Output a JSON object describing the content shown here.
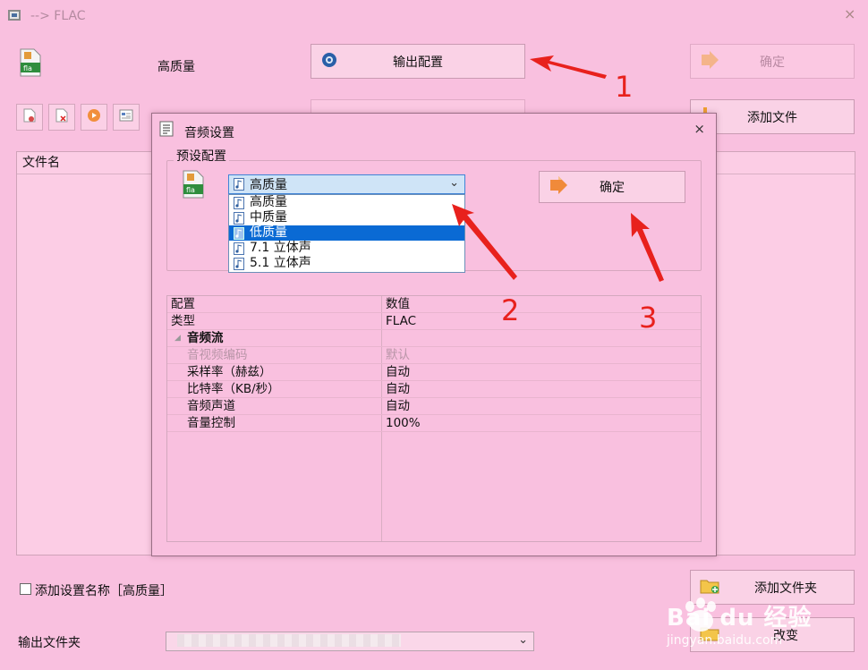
{
  "window": {
    "title": "--> FLAC",
    "close_glyph": "×"
  },
  "main": {
    "preset_name": "高质量",
    "output_config_label": "输出配置",
    "ok_label": "确定",
    "add_file_label": "添加文件",
    "add_folder_label": "添加文件夹",
    "change_label": "改变",
    "file_col_header": "文件名",
    "add_setting_name_label": "添加设置名称［高质量］",
    "output_folder_label": "输出文件夹"
  },
  "dialog": {
    "title": "音频设置",
    "close_glyph": "×",
    "preset_group_label": "预设配置",
    "combo_value": "高质量",
    "options": [
      "高质量",
      "中质量",
      "低质量",
      "7.1 立体声",
      "5.1 立体声"
    ],
    "selected_index": 2,
    "ok_label": "确定",
    "grid": {
      "col_headers": [
        "配置",
        "数值"
      ],
      "rows": [
        {
          "name": "类型",
          "value": "FLAC"
        },
        {
          "name": "音频流",
          "value": ""
        },
        {
          "name": "音视频编码",
          "value": "默认"
        },
        {
          "name": "采样率（赫兹）",
          "value": "自动"
        },
        {
          "name": "比特率（KB/秒）",
          "value": "自动"
        },
        {
          "name": "音频声道",
          "value": "自动"
        },
        {
          "name": "音量控制",
          "value": "100%"
        }
      ]
    }
  },
  "annotations": {
    "labels": [
      "1",
      "2",
      "3"
    ],
    "color": "#e8211d"
  },
  "watermark": {
    "brand": "Bai du 经验",
    "url": "jingyan.baidu.com"
  },
  "colors": {
    "background": "#f9c0df",
    "selection": "#0a6ad4"
  }
}
